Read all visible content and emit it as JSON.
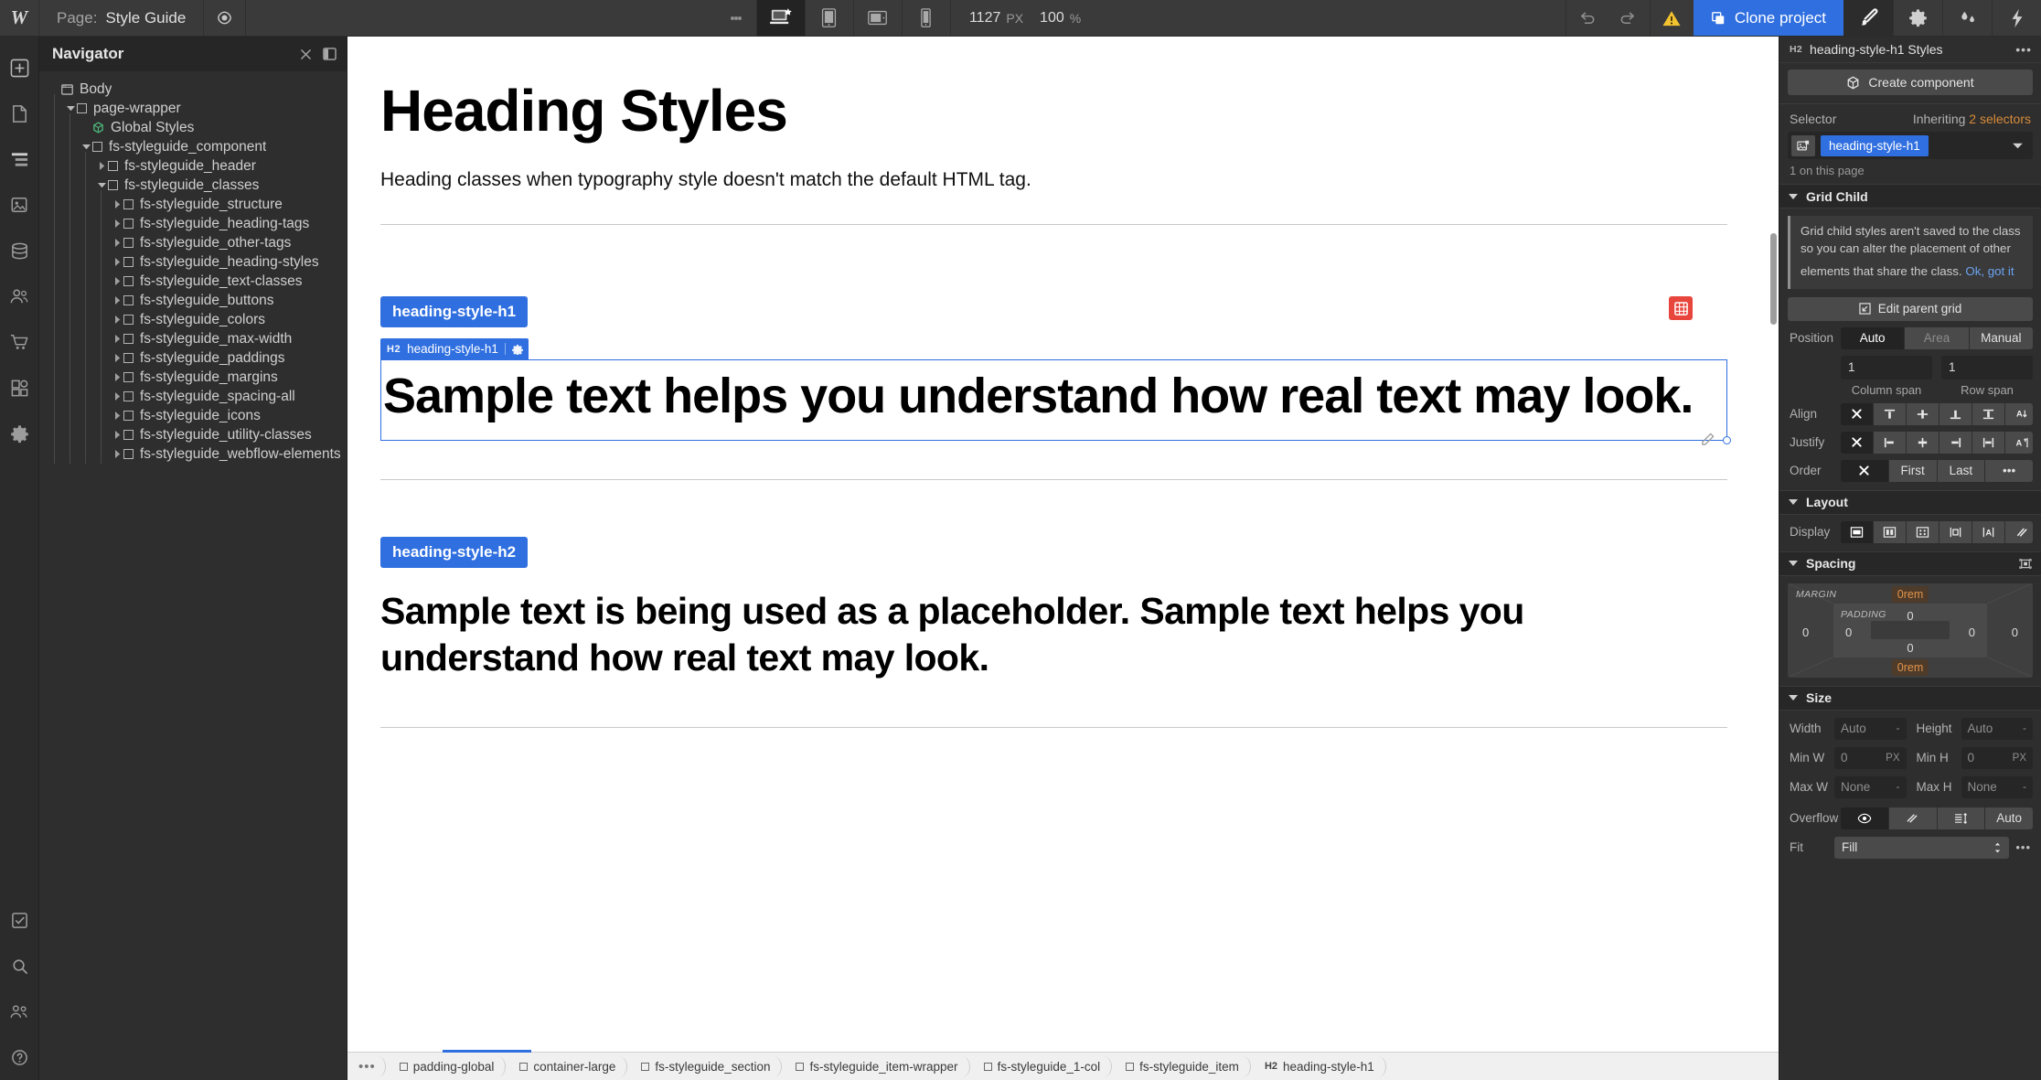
{
  "topbar": {
    "logo": "W",
    "page_label": "Page:",
    "page_name": "Style Guide",
    "preview_icon": "eye-icon",
    "menu_icon": "more-vertical-icon",
    "breakpoints": [
      {
        "name": "desktop-large",
        "icon": "desktop-star-icon",
        "active": true
      },
      {
        "name": "tablet",
        "icon": "tablet-icon",
        "active": false
      },
      {
        "name": "mobile-landscape",
        "icon": "mobile-landscape-icon",
        "active": false
      },
      {
        "name": "mobile-portrait",
        "icon": "mobile-portrait-icon",
        "active": false
      }
    ],
    "viewport_width": "1127",
    "viewport_unit": "PX",
    "zoom_value": "100",
    "zoom_unit": "%",
    "undo_icon": "undo-icon",
    "redo_icon": "redo-icon",
    "warning_icon": "warning-triangle-icon",
    "clone_label": "Clone project",
    "clone_icon": "copy-icon",
    "clone_color": "#2f6fe0",
    "right_icons": [
      {
        "name": "brush-icon",
        "active": true
      },
      {
        "name": "gear-icon",
        "active": false
      },
      {
        "name": "droplets-icon",
        "active": false
      },
      {
        "name": "lightning-icon",
        "active": false
      }
    ]
  },
  "rail": {
    "items": [
      {
        "name": "add-element-icon"
      },
      {
        "name": "pages-icon"
      },
      {
        "name": "navigator-icon"
      },
      {
        "name": "assets-icon"
      },
      {
        "name": "cms-icon"
      },
      {
        "name": "users-icon"
      },
      {
        "name": "ecommerce-icon"
      },
      {
        "name": "components-icon"
      },
      {
        "name": "settings-icon"
      }
    ],
    "bottom_items": [
      {
        "name": "audit-icon"
      },
      {
        "name": "search-icon"
      },
      {
        "name": "people-icon"
      },
      {
        "name": "help-icon"
      }
    ]
  },
  "navigator": {
    "title": "Navigator",
    "close_icon": "close-icon",
    "panel_icon": "panel-toggle-icon",
    "tree": [
      {
        "label": "Body",
        "depth": 0,
        "icon": "body-icon",
        "twisty": "none"
      },
      {
        "label": "page-wrapper",
        "depth": 1,
        "icon": "box-icon",
        "twisty": "open"
      },
      {
        "label": "Global Styles",
        "depth": 2,
        "icon": "component-icon",
        "twisty": "none"
      },
      {
        "label": "fs-styleguide_component",
        "depth": 2,
        "icon": "box-icon",
        "twisty": "open"
      },
      {
        "label": "fs-styleguide_header",
        "depth": 3,
        "icon": "box-icon",
        "twisty": "closed"
      },
      {
        "label": "fs-styleguide_classes",
        "depth": 3,
        "icon": "box-icon",
        "twisty": "open"
      },
      {
        "label": "fs-styleguide_structure",
        "depth": 4,
        "icon": "box-icon",
        "twisty": "closed"
      },
      {
        "label": "fs-styleguide_heading-tags",
        "depth": 4,
        "icon": "box-icon",
        "twisty": "closed"
      },
      {
        "label": "fs-styleguide_other-tags",
        "depth": 4,
        "icon": "box-icon",
        "twisty": "closed"
      },
      {
        "label": "fs-styleguide_heading-styles",
        "depth": 4,
        "icon": "box-icon",
        "twisty": "closed"
      },
      {
        "label": "fs-styleguide_text-classes",
        "depth": 4,
        "icon": "box-icon",
        "twisty": "closed"
      },
      {
        "label": "fs-styleguide_buttons",
        "depth": 4,
        "icon": "box-icon",
        "twisty": "closed"
      },
      {
        "label": "fs-styleguide_colors",
        "depth": 4,
        "icon": "box-icon",
        "twisty": "closed"
      },
      {
        "label": "fs-styleguide_max-width",
        "depth": 4,
        "icon": "box-icon",
        "twisty": "closed"
      },
      {
        "label": "fs-styleguide_paddings",
        "depth": 4,
        "icon": "box-icon",
        "twisty": "closed"
      },
      {
        "label": "fs-styleguide_margins",
        "depth": 4,
        "icon": "box-icon",
        "twisty": "closed"
      },
      {
        "label": "fs-styleguide_spacing-all",
        "depth": 4,
        "icon": "box-icon",
        "twisty": "closed"
      },
      {
        "label": "fs-styleguide_icons",
        "depth": 4,
        "icon": "box-icon",
        "twisty": "closed"
      },
      {
        "label": "fs-styleguide_utility-classes",
        "depth": 4,
        "icon": "box-icon",
        "twisty": "closed"
      },
      {
        "label": "fs-styleguide_webflow-elements",
        "depth": 4,
        "icon": "box-icon",
        "twisty": "closed"
      }
    ]
  },
  "canvas": {
    "h1": "Heading Styles",
    "intro": "Heading classes when typography style doesn't match the default HTML tag.",
    "block1": {
      "pill": "heading-style-h1",
      "selected_tag": "H2",
      "selected_label": "heading-style-h1",
      "gear_icon": "gear-icon",
      "text": "Sample text helps you understand how real text may look.",
      "grid_badge_icon": "grid-icon",
      "grid_badge_color": "#e8453c"
    },
    "block2": {
      "pill": "heading-style-h2",
      "text": "Sample text is being used as a placeholder. Sample text helps you understand how real text may look."
    },
    "edit_icon": "pencil-icon"
  },
  "breadcrumbs": {
    "overflow": "•••",
    "items": [
      {
        "label": "padding-global",
        "tag": "",
        "icon": "box-icon"
      },
      {
        "label": "container-large",
        "tag": "",
        "icon": "box-icon"
      },
      {
        "label": "fs-styleguide_section",
        "tag": "",
        "icon": "box-icon"
      },
      {
        "label": "fs-styleguide_item-wrapper",
        "tag": "",
        "icon": "box-icon"
      },
      {
        "label": "fs-styleguide_1-col",
        "tag": "",
        "icon": "box-icon"
      },
      {
        "label": "fs-styleguide_item",
        "tag": "",
        "icon": "box-icon"
      },
      {
        "label": "heading-style-h1",
        "tag": "H2",
        "icon": ""
      }
    ]
  },
  "style_panel": {
    "header": {
      "tag": "H2",
      "title": "heading-style-h1 Styles",
      "menu_icon": "more-horizontal-icon"
    },
    "create_component": {
      "label": "Create component",
      "icon": "component-icon"
    },
    "selector": {
      "label": "Selector",
      "inheriting_prefix": "Inheriting",
      "inheriting_count": "2 selectors",
      "image_icon": "element-icon",
      "chip": "heading-style-h1",
      "caret_icon": "chevron-down-icon",
      "on_page": "1 on this page",
      "chip_color": "#2f6fe0",
      "inheriting_color": "#d98c3a"
    },
    "grid_child": {
      "title": "Grid Child",
      "notice": "Grid child styles aren't saved to the class so you can alter the placement of other elements that share the class.",
      "notice_link": "Ok, got it",
      "edit_parent_grid": "Edit parent grid",
      "edit_parent_grid_icon": "arrow-into-box-icon",
      "position_label": "Position",
      "position_options": [
        {
          "label": "Auto",
          "state": "on"
        },
        {
          "label": "Area",
          "state": "dim"
        },
        {
          "label": "Manual",
          "state": "off"
        }
      ],
      "column_span_value": "1",
      "column_span_label": "Column span",
      "row_span_value": "1",
      "row_span_label": "Row span",
      "align_label": "Align",
      "align_options": [
        {
          "icon": "none-x-icon",
          "state": "on"
        },
        {
          "icon": "align-start-icon",
          "state": "off"
        },
        {
          "icon": "align-center-icon",
          "state": "off"
        },
        {
          "icon": "align-end-icon",
          "state": "off"
        },
        {
          "icon": "align-stretch-icon",
          "state": "off"
        },
        {
          "icon": "align-baseline-icon",
          "state": "off"
        }
      ],
      "justify_label": "Justify",
      "justify_options": [
        {
          "icon": "none-x-icon",
          "state": "on"
        },
        {
          "icon": "justify-start-icon",
          "state": "off"
        },
        {
          "icon": "justify-center-icon",
          "state": "off"
        },
        {
          "icon": "justify-end-icon",
          "state": "off"
        },
        {
          "icon": "justify-stretch-icon",
          "state": "off"
        },
        {
          "icon": "justify-baseline-icon",
          "state": "off"
        }
      ],
      "order_label": "Order",
      "order_options": [
        {
          "label": "",
          "icon": "none-x-icon",
          "state": "on"
        },
        {
          "label": "First",
          "icon": "",
          "state": "off"
        },
        {
          "label": "Last",
          "icon": "",
          "state": "off"
        },
        {
          "label": "•••",
          "icon": "",
          "state": "off"
        }
      ]
    },
    "layout": {
      "title": "Layout",
      "display_label": "Display",
      "display_options": [
        {
          "icon": "display-block-icon",
          "state": "on"
        },
        {
          "icon": "display-flex-icon",
          "state": "off"
        },
        {
          "icon": "display-grid-icon",
          "state": "off"
        },
        {
          "icon": "display-inline-block-icon",
          "state": "off"
        },
        {
          "icon": "display-inline-icon",
          "state": "off"
        },
        {
          "icon": "display-none-icon",
          "state": "off"
        }
      ]
    },
    "spacing": {
      "title": "Spacing",
      "expand_icon": "expand-spacing-icon",
      "margin_label": "MARGIN",
      "padding_label": "PADDING",
      "margin_top": "0rem",
      "margin_bottom": "0rem",
      "margin_left": "0",
      "margin_right": "0",
      "padding_top": "0",
      "padding_bottom": "0",
      "padding_left": "0",
      "padding_right": "0",
      "accent_color": "#e2944a"
    },
    "size": {
      "title": "Size",
      "width_label": "Width",
      "width_value": "Auto",
      "width_unit": "-",
      "height_label": "Height",
      "height_value": "Auto",
      "height_unit": "-",
      "min_w_label": "Min W",
      "min_w_value": "0",
      "min_w_unit": "PX",
      "min_h_label": "Min H",
      "min_h_value": "0",
      "min_h_unit": "PX",
      "max_w_label": "Max W",
      "max_w_value": "None",
      "max_w_unit": "-",
      "max_h_label": "Max H",
      "max_h_value": "None",
      "max_h_unit": "-",
      "overflow_label": "Overflow",
      "overflow_options": [
        {
          "icon": "eye-icon",
          "label": "",
          "state": "on"
        },
        {
          "icon": "eye-off-icon",
          "label": "",
          "state": "off"
        },
        {
          "icon": "scroll-icon",
          "label": "",
          "state": "off"
        },
        {
          "icon": "",
          "label": "Auto",
          "state": "off"
        }
      ],
      "fit_label": "Fit",
      "fit_value": "Fill",
      "fit_caret_icon": "updown-caret-icon",
      "fit_menu_icon": "more-horizontal-icon"
    }
  }
}
